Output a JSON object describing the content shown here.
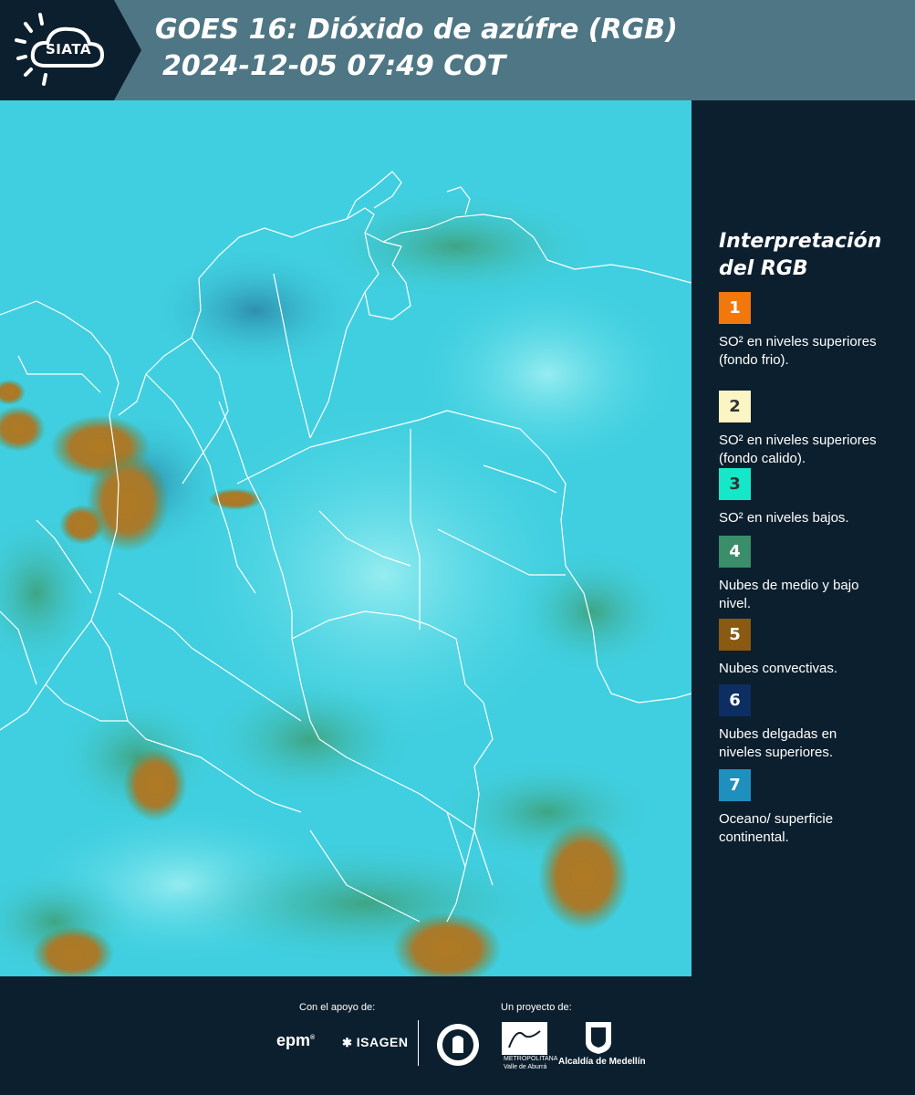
{
  "header": {
    "logo_text": "SIATA",
    "title": "GOES 16: Dióxido de azúfre (RGB)",
    "timestamp": "2024-12-05 07:49 COT"
  },
  "legend": {
    "title_line1": "Interpretación",
    "title_line2": "del RGB",
    "items": [
      {
        "num": "1",
        "color": "#f2780c",
        "text_color": "#ffffff",
        "label": "SO² en niveles superiores (fondo frio)."
      },
      {
        "num": "2",
        "color": "#fbf5c4",
        "text_color": "#333333",
        "label": "SO² en niveles superiores (fondo calido)."
      },
      {
        "num": "3",
        "color": "#14e8c8",
        "text_color": "#333333",
        "label": "SO² en niveles bajos."
      },
      {
        "num": "4",
        "color": "#3a8e6a",
        "text_color": "#ffffff",
        "label": "Nubes de medio y bajo nivel."
      },
      {
        "num": "5",
        "color": "#8a5a12",
        "text_color": "#ffffff",
        "label": "Nubes convectivas."
      },
      {
        "num": "6",
        "color": "#0d2e63",
        "text_color": "#ffffff",
        "label": "Nubes delgadas en niveles superiores."
      },
      {
        "num": "7",
        "color": "#1f8fbe",
        "text_color": "#ffffff",
        "label": "Oceano/ superficie continental."
      }
    ]
  },
  "footer": {
    "support_label": "Con el apoyo de:",
    "project_label": "Un proyecto de:",
    "epm": "epm",
    "isagen": "ISAGEN",
    "area_line1": "METROPOLITANA",
    "area_line2": "Valle de Aburrá",
    "alcaldia": "Alcaldía de Medellín"
  }
}
